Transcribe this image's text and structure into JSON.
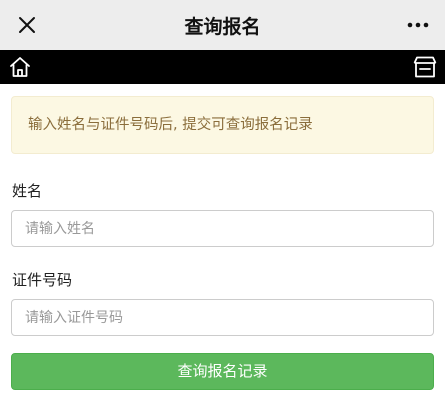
{
  "header": {
    "title": "查询报名",
    "close_icon": "close-icon",
    "more_icon": "more-icon"
  },
  "navbar": {
    "home_icon": "home-icon",
    "store_icon": "store-icon"
  },
  "notice": {
    "text": "输入姓名与证件号码后, 提交可查询报名记录"
  },
  "form": {
    "name_label": "姓名",
    "name_placeholder": "请输入姓名",
    "id_label": "证件号码",
    "id_placeholder": "请输入证件号码",
    "submit_label": "查询报名记录"
  },
  "colors": {
    "submit_green": "#5cb85c",
    "notice_bg": "#fcf8e3",
    "notice_text": "#8a6d3b"
  }
}
